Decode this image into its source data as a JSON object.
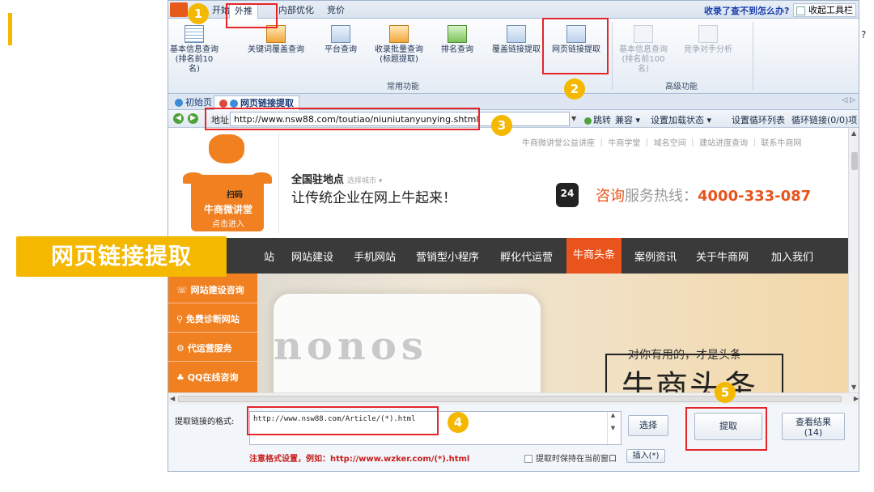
{
  "callout": "网页链接提取",
  "toolbar_tabs": [
    "开始",
    "外推",
    "内部优化",
    "竞价"
  ],
  "toolbar_right": {
    "link": "收录了查不到怎么办?",
    "collapse": "收起工具栏"
  },
  "ribbon": {
    "buttons": [
      {
        "label1": "基本信息查询",
        "label2": "(排名前10名)"
      },
      {
        "label1": "关键词覆盖查询",
        "label2": ""
      },
      {
        "label1": "平台查询",
        "label2": ""
      },
      {
        "label1": "收录批量查询",
        "label2": "(标题提取)"
      },
      {
        "label1": "排名查询",
        "label2": ""
      },
      {
        "label1": "覆盖链接提取",
        "label2": ""
      },
      {
        "label1": "网页链接提取",
        "label2": ""
      },
      {
        "label1": "基本信息查询",
        "label2": "(排名前100名)"
      },
      {
        "label1": "竞争对手分析",
        "label2": ""
      }
    ],
    "group_common": "常用功能",
    "group_advanced": "高级功能"
  },
  "doc_tabs": {
    "home": "初始页",
    "active": "网页链接提取"
  },
  "address": {
    "label": "地址",
    "url": "http://www.nsw88.com/toutiao/niuniutanyunying.shtml",
    "go": "跳转",
    "compat": "兼容",
    "load_state": "设置加载状态",
    "loop_list": "设置循环列表",
    "loop_links": "循环链接(0/0)项"
  },
  "webpage": {
    "top_links": "牛商微讲堂公益讲座 ｜ 牛商学堂 ｜ 域名空间 ｜ 建站进度查询 ｜ 联系牛商网",
    "mascot_title": "牛商微讲堂",
    "mascot_sub": "点击进入",
    "qr_label": "扫码",
    "nation": "全国驻地点",
    "city_select": "选择城市",
    "slogan": "让传统企业在网上牛起来！",
    "badge": "24",
    "hotline_lead": "咨询",
    "hotline_mid": "服务热线：",
    "hotline_num": "4000-333-087",
    "nav": [
      "站",
      "网站建设",
      "手机网站",
      "营销型小程序",
      "孵化代运营",
      "牛商头条",
      "案例资讯",
      "关于牛商网",
      "加入我们"
    ],
    "side_menu": [
      "网站建设咨询",
      "免费诊断网站",
      "代运营服务",
      "QQ在线咨询"
    ],
    "hero_word": "nonos",
    "hero_tag": "对你有用的，才是头条",
    "hero_big": "牛商头条"
  },
  "bottom": {
    "format_label": "提取链接的格式:",
    "format_value": "http://www.nsw88.com/Article/(*).html",
    "select_btn": "选择",
    "extract_btn": "提取",
    "result_btn_1": "查看结果",
    "result_btn_2": "(14)",
    "note": "注意格式设置，例如：http://www.wzker.com/(*).html",
    "keep_window": "提取时保持在当前窗口",
    "insert_btn": "插入(*)"
  },
  "steps": [
    "1",
    "2",
    "3",
    "4",
    "5"
  ],
  "colors": {
    "accent": "#f5b800",
    "highlight": "#e5252a",
    "brand": "#e8541c",
    "ribbon_blue": "#1f3352"
  }
}
